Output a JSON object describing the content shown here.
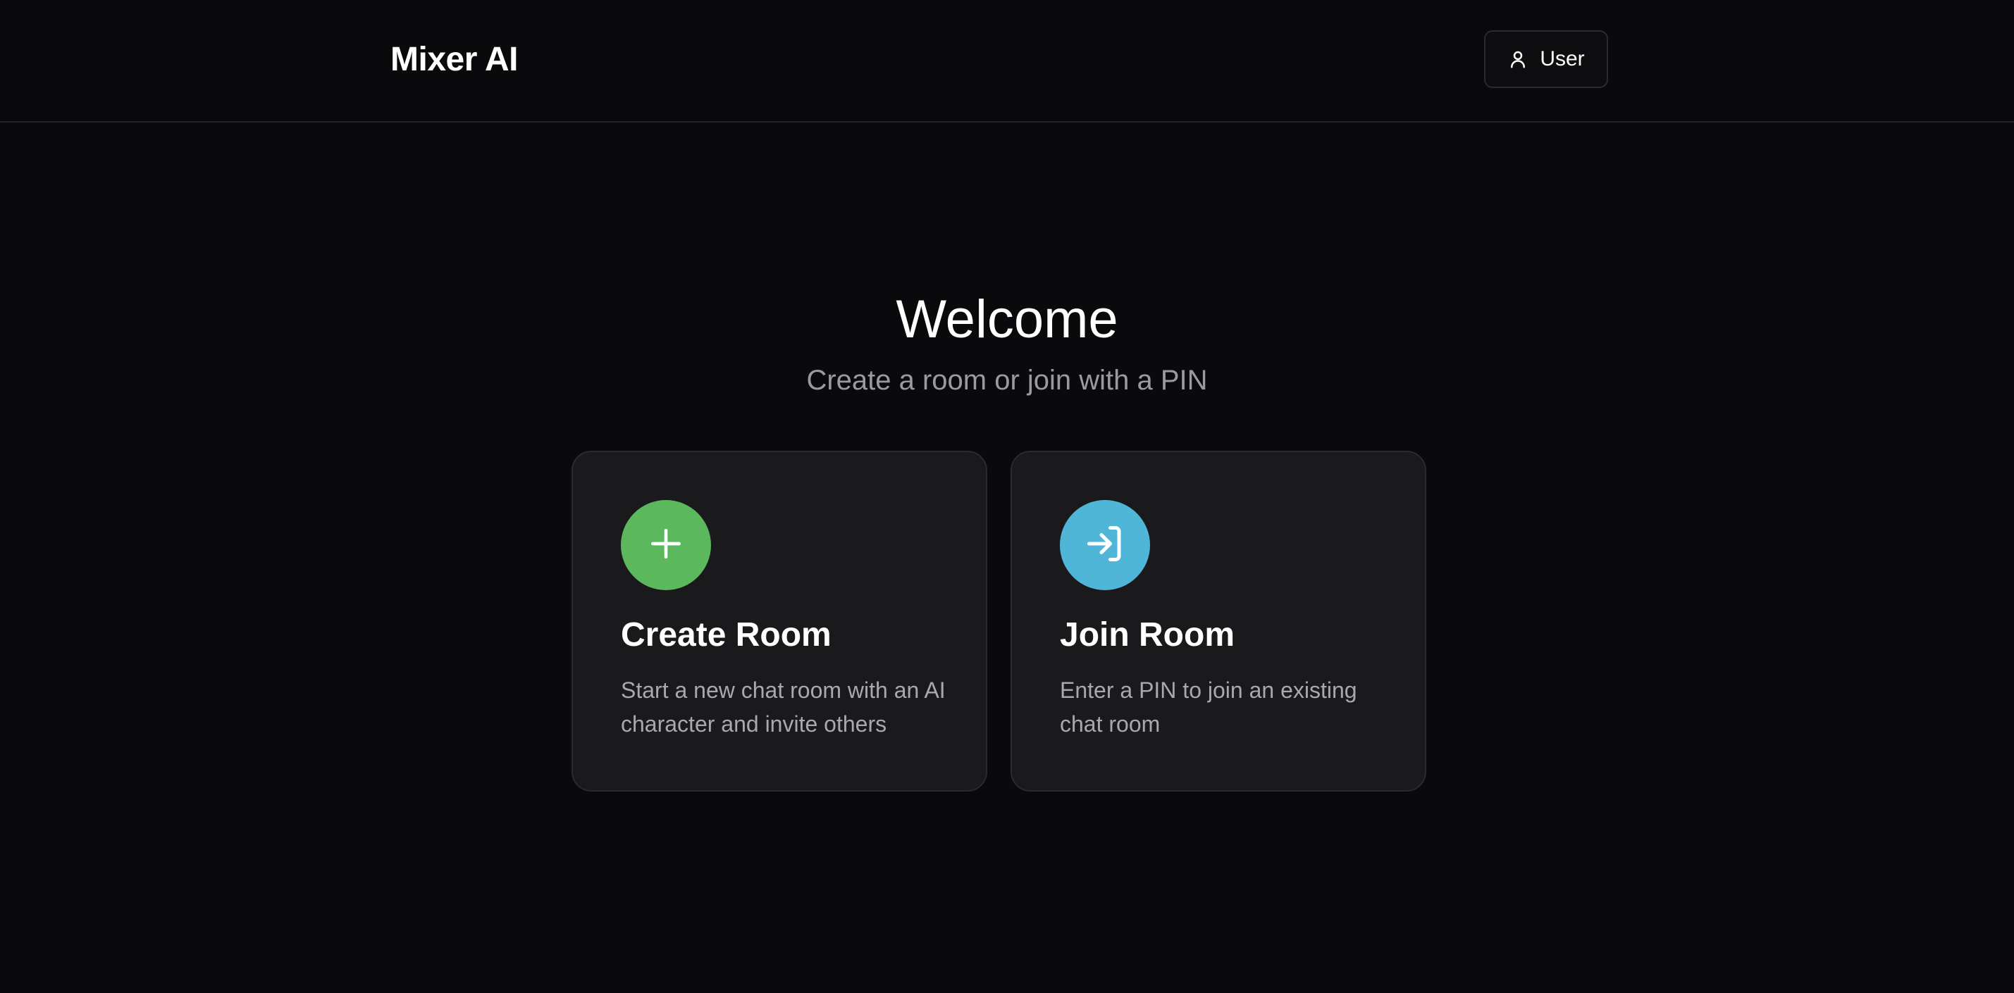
{
  "header": {
    "brand": "Mixer AI",
    "user_button": {
      "label": "User",
      "icon": "user-icon"
    }
  },
  "hero": {
    "title": "Welcome",
    "subtitle": "Create a room or join with a PIN"
  },
  "cards": [
    {
      "title": "Create Room",
      "description": "Start a new chat room with an AI character and invite others",
      "icon": "plus-icon",
      "color": "#5cb85c"
    },
    {
      "title": "Join Room",
      "description": "Enter a PIN to join an existing chat room",
      "icon": "login-icon",
      "color": "#4fb6d8"
    }
  ],
  "colors": {
    "background": "#0a0a0c",
    "card": "#1a1a1d",
    "border": "#2a2a2f",
    "muted_text": "#9a9aa2"
  }
}
